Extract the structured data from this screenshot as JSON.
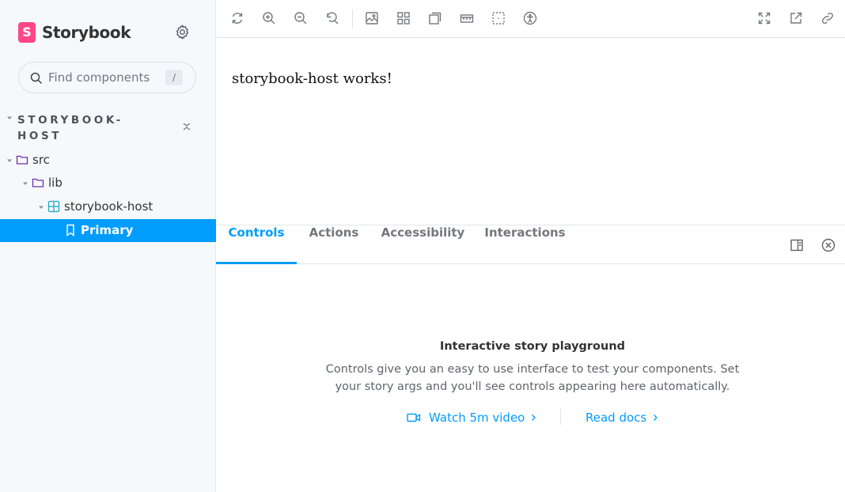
{
  "brand": {
    "logo_letter": "S",
    "name": "Storybook",
    "accent": "#ff4785"
  },
  "search": {
    "placeholder": "Find components",
    "shortcut": "/"
  },
  "sidebar": {
    "section_title": "STORYBOOK-HOST",
    "tree": [
      {
        "label": "src",
        "icon": "folder-icon"
      },
      {
        "label": "lib",
        "icon": "folder-icon"
      },
      {
        "label": "storybook-host",
        "icon": "component-icon"
      },
      {
        "label": "Primary",
        "icon": "bookmark-icon",
        "selected": true
      }
    ]
  },
  "toolbar": {
    "left_tools": [
      "reload-icon",
      "zoom-in-icon",
      "zoom-out-icon",
      "reset-zoom-icon",
      "background-icon",
      "grid-icon",
      "viewport-icon",
      "measure-icon",
      "outline-icon",
      "accessibility-icon"
    ],
    "right_tools": [
      "fullscreen-icon",
      "open-new-tab-icon",
      "copy-link-icon"
    ]
  },
  "preview": {
    "text": "storybook-host works!"
  },
  "panel": {
    "tabs": [
      "Controls",
      "Actions",
      "Accessibility",
      "Interactions"
    ],
    "active_tab": "Controls",
    "empty_title": "Interactive story playground",
    "empty_desc": "Controls give you an easy to use interface to test your components. Set your story args and you'll see controls appearing here automatically.",
    "video_link": "Watch 5m video",
    "docs_link": "Read docs"
  },
  "colors": {
    "primary": "#029cfd",
    "sidebar_bg": "#f6f9fc"
  }
}
